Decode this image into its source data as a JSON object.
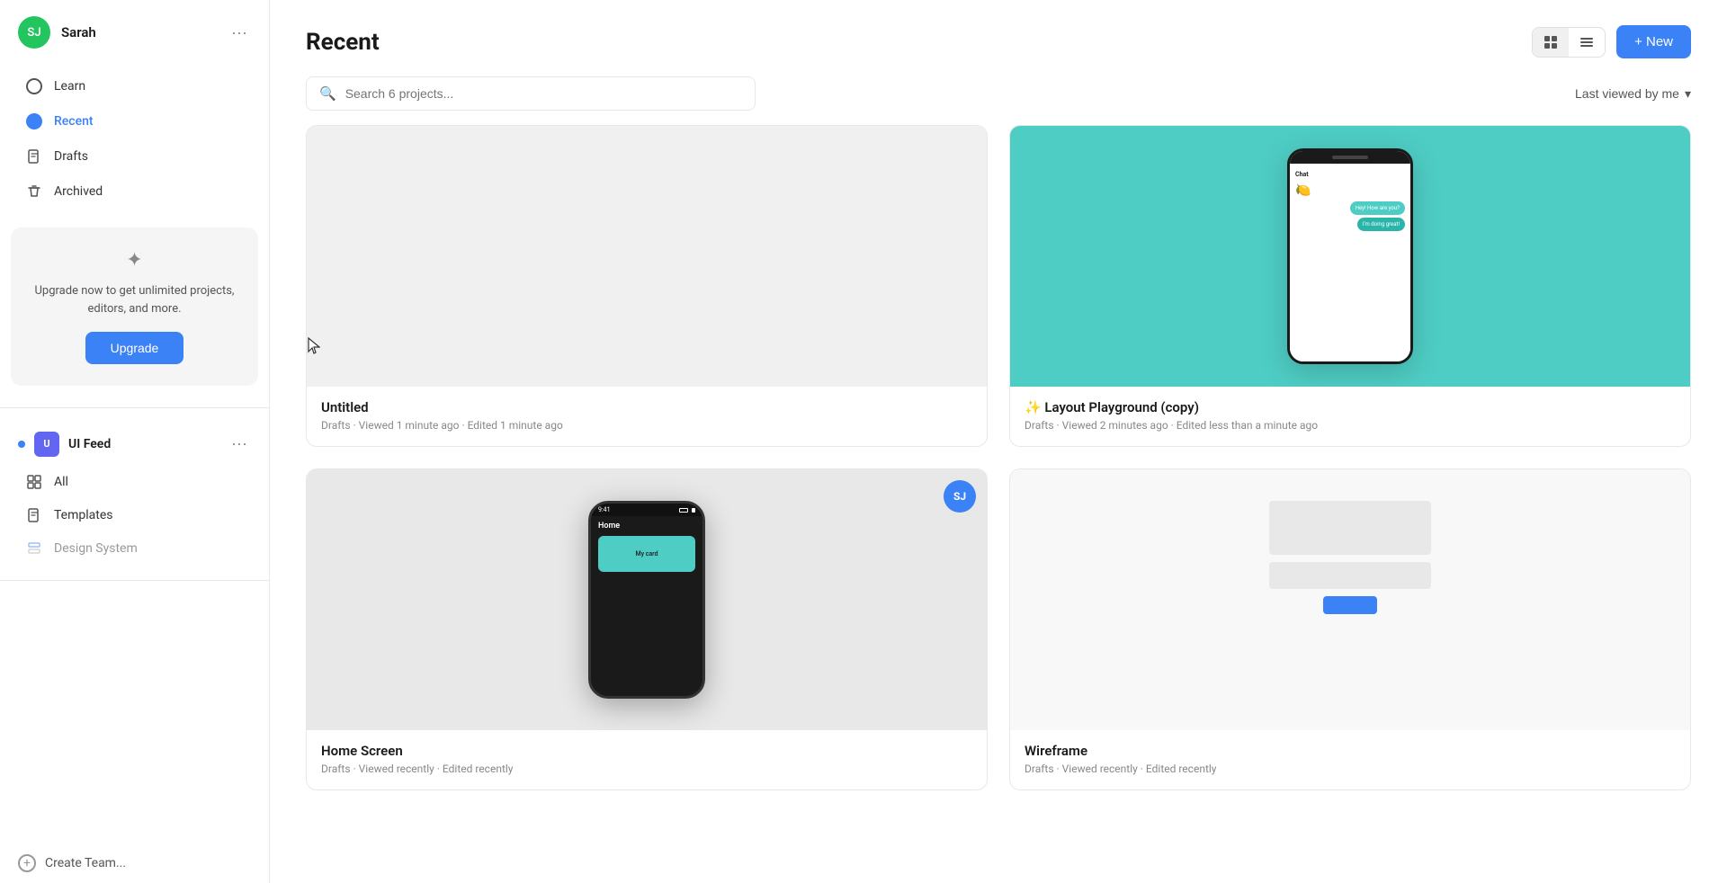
{
  "user": {
    "initials": "SJ",
    "name": "Sarah"
  },
  "sidebar": {
    "nav_items": [
      {
        "id": "learn",
        "label": "Learn",
        "icon": "circle-empty"
      },
      {
        "id": "recent",
        "label": "Recent",
        "icon": "circle-filled",
        "active": true
      },
      {
        "id": "drafts",
        "label": "Drafts",
        "icon": "file"
      },
      {
        "id": "archived",
        "label": "Archived",
        "icon": "trash"
      }
    ],
    "upgrade_card": {
      "text": "Upgrade now to get unlimited projects, editors, and more.",
      "button_label": "Upgrade"
    },
    "team": {
      "name": "UI Feed",
      "initials": "U",
      "items": [
        {
          "id": "all",
          "label": "All",
          "icon": "grid"
        },
        {
          "id": "templates",
          "label": "Templates",
          "icon": "file"
        },
        {
          "id": "design-system",
          "label": "Design System",
          "icon": "layers"
        }
      ]
    },
    "create_team_label": "Create Team..."
  },
  "main": {
    "title": "Recent",
    "search_placeholder": "Search 6 projects...",
    "sort_label": "Last viewed by me",
    "new_button_label": "+ New",
    "projects": [
      {
        "id": "untitled",
        "name": "Untitled",
        "location": "Drafts",
        "viewed": "Viewed 1 minute ago",
        "edited": "Edited 1 minute ago",
        "type": "empty"
      },
      {
        "id": "layout-playground",
        "name": "✨ Layout Playground (copy)",
        "location": "Drafts",
        "viewed": "Viewed 2 minutes ago",
        "edited": "Edited less than a minute ago",
        "type": "phone-chat"
      },
      {
        "id": "home-screen",
        "name": "Home Screen",
        "location": "Drafts",
        "viewed": "Viewed recently",
        "edited": "Edited recently",
        "type": "phone-home",
        "has_user": true
      },
      {
        "id": "wireframe",
        "name": "Wireframe",
        "location": "Drafts",
        "viewed": "Viewed recently",
        "edited": "Edited recently",
        "type": "wireframe"
      }
    ]
  }
}
